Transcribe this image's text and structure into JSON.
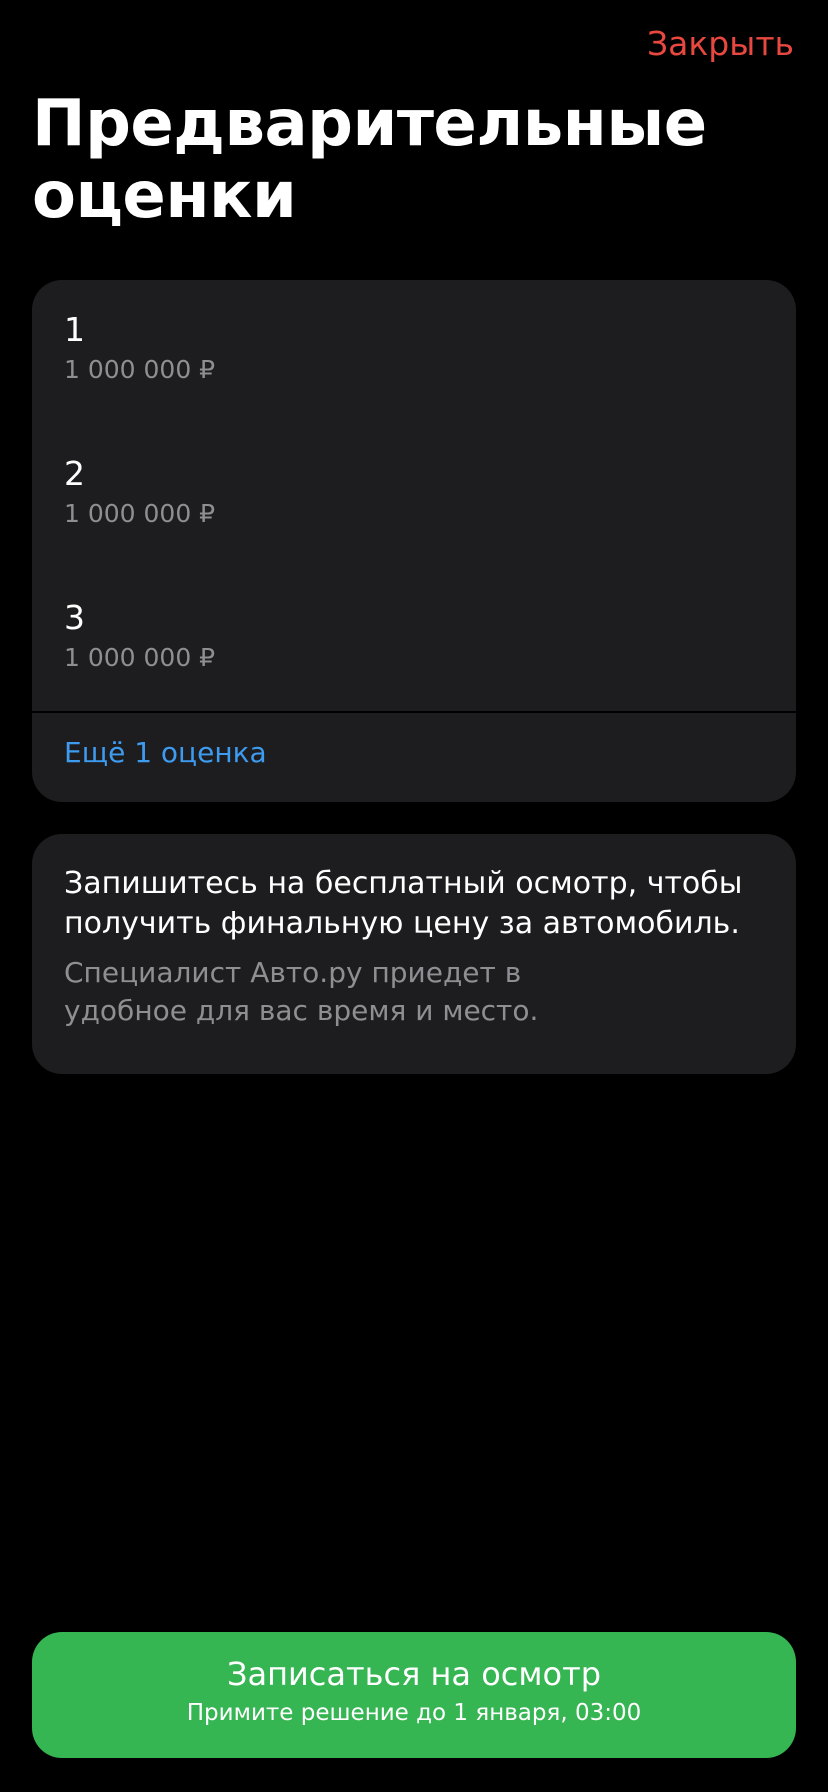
{
  "header": {
    "close_label": "Закрыть",
    "title": "Предварительные оценки"
  },
  "estimates": {
    "items": [
      {
        "name": "1",
        "price": "1 000 000 ₽"
      },
      {
        "name": "2",
        "price": "1 000 000 ₽"
      },
      {
        "name": "3",
        "price": "1 000 000 ₽"
      }
    ],
    "more_label": "Ещё 1 оценка"
  },
  "info": {
    "title": "Запишитесь на бесплатный осмотр, чтобы получить финальную цену за автомобиль.",
    "description": "Специалист Авто.ру приедет в удобное для вас время и место."
  },
  "cta": {
    "label": "Записаться на осмотр",
    "sublabel": "Примите решение до 1 января, 03:00"
  },
  "colors": {
    "background": "#000000",
    "card": "#1d1d1f",
    "accent_red": "#e8483f",
    "link_blue": "#3d9bf0",
    "button_green": "#35b652",
    "secondary_text": "#8e8e93"
  }
}
